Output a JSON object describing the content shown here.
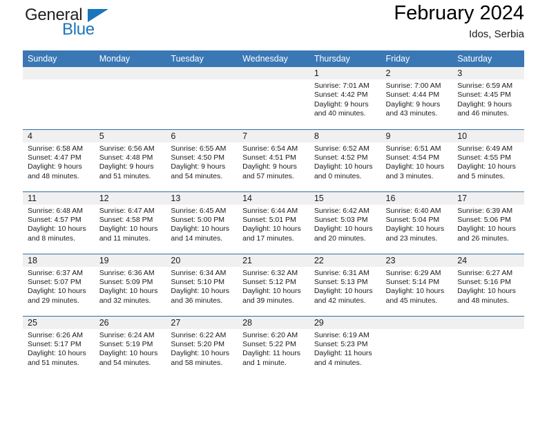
{
  "brand": {
    "name_part1": "General",
    "name_part2": "Blue",
    "logo_icon": "triangle-flag-icon",
    "accent_color": "#1b75bb"
  },
  "header": {
    "title": "February 2024",
    "location": "Idos, Serbia"
  },
  "calendar": {
    "header_bg": "#3a77b5",
    "row_border_color": "#2f6ea5",
    "daynum_band_bg": "#f0f0f0",
    "weekday_headers": [
      "Sunday",
      "Monday",
      "Tuesday",
      "Wednesday",
      "Thursday",
      "Friday",
      "Saturday"
    ],
    "weeks": [
      [
        {
          "empty": true
        },
        {
          "empty": true
        },
        {
          "empty": true
        },
        {
          "empty": true
        },
        {
          "day": "1",
          "sunrise": "Sunrise: 7:01 AM",
          "sunset": "Sunset: 4:42 PM",
          "daylight_1": "Daylight: 9 hours",
          "daylight_2": "and 40 minutes."
        },
        {
          "day": "2",
          "sunrise": "Sunrise: 7:00 AM",
          "sunset": "Sunset: 4:44 PM",
          "daylight_1": "Daylight: 9 hours",
          "daylight_2": "and 43 minutes."
        },
        {
          "day": "3",
          "sunrise": "Sunrise: 6:59 AM",
          "sunset": "Sunset: 4:45 PM",
          "daylight_1": "Daylight: 9 hours",
          "daylight_2": "and 46 minutes."
        }
      ],
      [
        {
          "day": "4",
          "sunrise": "Sunrise: 6:58 AM",
          "sunset": "Sunset: 4:47 PM",
          "daylight_1": "Daylight: 9 hours",
          "daylight_2": "and 48 minutes."
        },
        {
          "day": "5",
          "sunrise": "Sunrise: 6:56 AM",
          "sunset": "Sunset: 4:48 PM",
          "daylight_1": "Daylight: 9 hours",
          "daylight_2": "and 51 minutes."
        },
        {
          "day": "6",
          "sunrise": "Sunrise: 6:55 AM",
          "sunset": "Sunset: 4:50 PM",
          "daylight_1": "Daylight: 9 hours",
          "daylight_2": "and 54 minutes."
        },
        {
          "day": "7",
          "sunrise": "Sunrise: 6:54 AM",
          "sunset": "Sunset: 4:51 PM",
          "daylight_1": "Daylight: 9 hours",
          "daylight_2": "and 57 minutes."
        },
        {
          "day": "8",
          "sunrise": "Sunrise: 6:52 AM",
          "sunset": "Sunset: 4:52 PM",
          "daylight_1": "Daylight: 10 hours",
          "daylight_2": "and 0 minutes."
        },
        {
          "day": "9",
          "sunrise": "Sunrise: 6:51 AM",
          "sunset": "Sunset: 4:54 PM",
          "daylight_1": "Daylight: 10 hours",
          "daylight_2": "and 3 minutes."
        },
        {
          "day": "10",
          "sunrise": "Sunrise: 6:49 AM",
          "sunset": "Sunset: 4:55 PM",
          "daylight_1": "Daylight: 10 hours",
          "daylight_2": "and 5 minutes."
        }
      ],
      [
        {
          "day": "11",
          "sunrise": "Sunrise: 6:48 AM",
          "sunset": "Sunset: 4:57 PM",
          "daylight_1": "Daylight: 10 hours",
          "daylight_2": "and 8 minutes."
        },
        {
          "day": "12",
          "sunrise": "Sunrise: 6:47 AM",
          "sunset": "Sunset: 4:58 PM",
          "daylight_1": "Daylight: 10 hours",
          "daylight_2": "and 11 minutes."
        },
        {
          "day": "13",
          "sunrise": "Sunrise: 6:45 AM",
          "sunset": "Sunset: 5:00 PM",
          "daylight_1": "Daylight: 10 hours",
          "daylight_2": "and 14 minutes."
        },
        {
          "day": "14",
          "sunrise": "Sunrise: 6:44 AM",
          "sunset": "Sunset: 5:01 PM",
          "daylight_1": "Daylight: 10 hours",
          "daylight_2": "and 17 minutes."
        },
        {
          "day": "15",
          "sunrise": "Sunrise: 6:42 AM",
          "sunset": "Sunset: 5:03 PM",
          "daylight_1": "Daylight: 10 hours",
          "daylight_2": "and 20 minutes."
        },
        {
          "day": "16",
          "sunrise": "Sunrise: 6:40 AM",
          "sunset": "Sunset: 5:04 PM",
          "daylight_1": "Daylight: 10 hours",
          "daylight_2": "and 23 minutes."
        },
        {
          "day": "17",
          "sunrise": "Sunrise: 6:39 AM",
          "sunset": "Sunset: 5:06 PM",
          "daylight_1": "Daylight: 10 hours",
          "daylight_2": "and 26 minutes."
        }
      ],
      [
        {
          "day": "18",
          "sunrise": "Sunrise: 6:37 AM",
          "sunset": "Sunset: 5:07 PM",
          "daylight_1": "Daylight: 10 hours",
          "daylight_2": "and 29 minutes."
        },
        {
          "day": "19",
          "sunrise": "Sunrise: 6:36 AM",
          "sunset": "Sunset: 5:09 PM",
          "daylight_1": "Daylight: 10 hours",
          "daylight_2": "and 32 minutes."
        },
        {
          "day": "20",
          "sunrise": "Sunrise: 6:34 AM",
          "sunset": "Sunset: 5:10 PM",
          "daylight_1": "Daylight: 10 hours",
          "daylight_2": "and 36 minutes."
        },
        {
          "day": "21",
          "sunrise": "Sunrise: 6:32 AM",
          "sunset": "Sunset: 5:12 PM",
          "daylight_1": "Daylight: 10 hours",
          "daylight_2": "and 39 minutes."
        },
        {
          "day": "22",
          "sunrise": "Sunrise: 6:31 AM",
          "sunset": "Sunset: 5:13 PM",
          "daylight_1": "Daylight: 10 hours",
          "daylight_2": "and 42 minutes."
        },
        {
          "day": "23",
          "sunrise": "Sunrise: 6:29 AM",
          "sunset": "Sunset: 5:14 PM",
          "daylight_1": "Daylight: 10 hours",
          "daylight_2": "and 45 minutes."
        },
        {
          "day": "24",
          "sunrise": "Sunrise: 6:27 AM",
          "sunset": "Sunset: 5:16 PM",
          "daylight_1": "Daylight: 10 hours",
          "daylight_2": "and 48 minutes."
        }
      ],
      [
        {
          "day": "25",
          "sunrise": "Sunrise: 6:26 AM",
          "sunset": "Sunset: 5:17 PM",
          "daylight_1": "Daylight: 10 hours",
          "daylight_2": "and 51 minutes."
        },
        {
          "day": "26",
          "sunrise": "Sunrise: 6:24 AM",
          "sunset": "Sunset: 5:19 PM",
          "daylight_1": "Daylight: 10 hours",
          "daylight_2": "and 54 minutes."
        },
        {
          "day": "27",
          "sunrise": "Sunrise: 6:22 AM",
          "sunset": "Sunset: 5:20 PM",
          "daylight_1": "Daylight: 10 hours",
          "daylight_2": "and 58 minutes."
        },
        {
          "day": "28",
          "sunrise": "Sunrise: 6:20 AM",
          "sunset": "Sunset: 5:22 PM",
          "daylight_1": "Daylight: 11 hours",
          "daylight_2": "and 1 minute."
        },
        {
          "day": "29",
          "sunrise": "Sunrise: 6:19 AM",
          "sunset": "Sunset: 5:23 PM",
          "daylight_1": "Daylight: 11 hours",
          "daylight_2": "and 4 minutes."
        },
        {
          "empty": true
        },
        {
          "empty": true
        }
      ]
    ]
  }
}
